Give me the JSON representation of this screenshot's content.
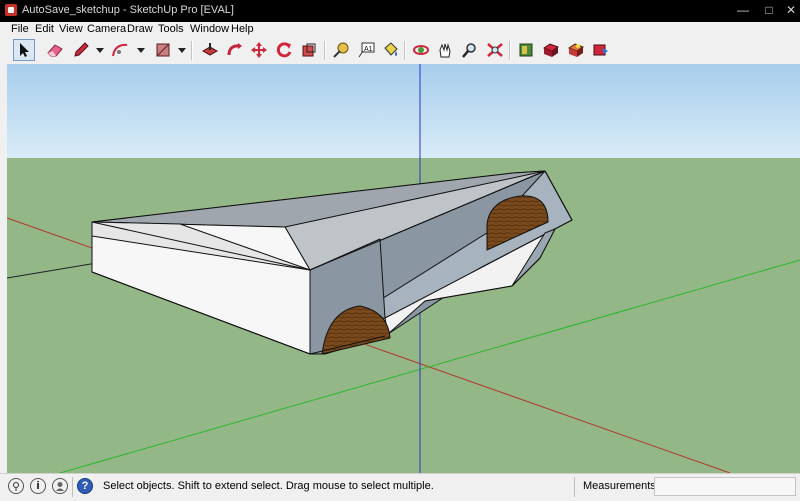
{
  "window": {
    "title": "AutoSave_sketchup - SketchUp Pro [EVAL]",
    "minimize_icon": "minimize-icon",
    "maximize_icon": "maximize-icon",
    "close_icon": "close-icon",
    "minimize_glyph": "—",
    "maximize_glyph": "□",
    "close_glyph": "✕"
  },
  "menu": {
    "items": [
      "File",
      "Edit",
      "View",
      "Camera",
      "Draw",
      "Tools",
      "Window",
      "Help"
    ]
  },
  "toolbar": {
    "tools": [
      "select-icon",
      "eraser-icon",
      "pencil-icon",
      "arc-icon",
      "rectangle-icon",
      "push-pull-icon",
      "follow-me-icon",
      "move-icon",
      "rotate-icon",
      "offset-icon",
      "tape-measure-icon",
      "text-icon",
      "paint-bucket-icon",
      "orbit-icon",
      "pan-icon",
      "zoom-icon",
      "zoom-extents-icon",
      "3d-warehouse-icon",
      "share-model-icon",
      "components-icon",
      "extension-icon"
    ],
    "active_tool": "select-icon"
  },
  "viewport": {
    "sky_color": "#b3d5ef",
    "ground_color": "#93b786",
    "axis_red": "#b23a2c",
    "axis_green": "#2db52d",
    "axis_blue": "#2b35c9",
    "wood_color": "#7a4a1c"
  },
  "status": {
    "message": "Select objects. Shift to extend select. Drag mouse to select multiple.",
    "measurements_label": "Measurements",
    "measurements_value": "",
    "geo_icon": "geo-location-icon",
    "credits_icon": "credits-icon",
    "user_icon": "user-icon",
    "help_icon": "instructor-help-icon",
    "credits_glyph": "i",
    "help_glyph": "?"
  }
}
